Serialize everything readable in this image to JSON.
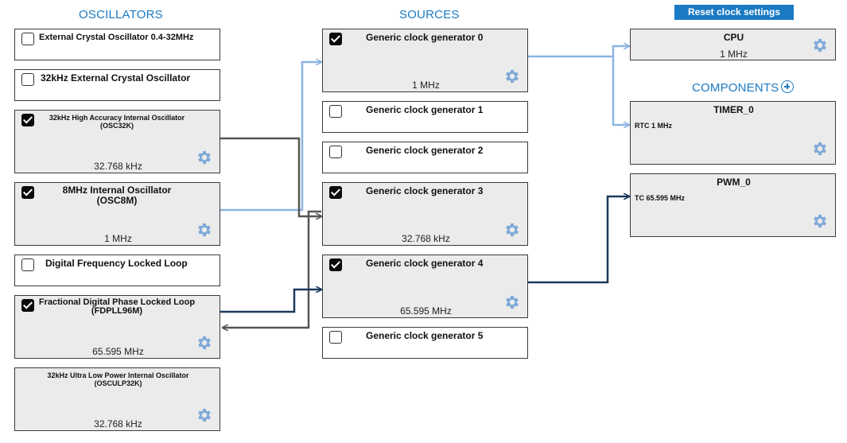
{
  "headers": {
    "oscillators": "OSCILLATORS",
    "sources": "SOURCES",
    "components": "COMPONENTS"
  },
  "reset_button": "Reset clock settings",
  "oscillators": [
    {
      "title": "External Crystal Oscillator 0.4-32MHz",
      "checked": false
    },
    {
      "title": "32kHz External Crystal Oscillator",
      "checked": false
    },
    {
      "title": "32kHz High Accuracy Internal Oscillator",
      "sub": "(OSC32K)",
      "checked": true,
      "freq": "32.768 kHz"
    },
    {
      "title": "8MHz Internal Oscillator",
      "sub": "(OSC8M)",
      "checked": true,
      "freq": "1 MHz"
    },
    {
      "title": "Digital Frequency Locked Loop",
      "checked": false
    },
    {
      "title": "Fractional Digital Phase Locked Loop",
      "sub": "(FDPLL96M)",
      "checked": true,
      "freq": "65.595 MHz"
    },
    {
      "title": "32kHz Ultra Low Power Internal Oscillator",
      "sub": "(OSCULP32K)",
      "freq": "32.768 kHz"
    }
  ],
  "sources": [
    {
      "title": "Generic clock generator 0",
      "checked": true,
      "freq": "1 MHz"
    },
    {
      "title": "Generic clock generator 1",
      "checked": false
    },
    {
      "title": "Generic clock generator 2",
      "checked": false
    },
    {
      "title": "Generic clock generator 3",
      "checked": true,
      "freq": "32.768 kHz"
    },
    {
      "title": "Generic clock generator 4",
      "checked": true,
      "freq": "65.595 MHz"
    },
    {
      "title": "Generic clock generator 5",
      "checked": false
    }
  ],
  "cpu": {
    "title": "CPU",
    "freq": "1 MHz"
  },
  "components": [
    {
      "title": "TIMER_0",
      "input": "RTC 1 MHz"
    },
    {
      "title": "PWM_0",
      "input": "TC 65.595 MHz"
    }
  ],
  "icons": {
    "checkbox": "checkbox-icon",
    "gear": "gear-icon",
    "plus": "add-circle-icon"
  },
  "colors": {
    "accent": "#1a7ac4",
    "gear": "#7fa9d8",
    "wire_light": "#8db4e2",
    "wire_dark": "#1b3a5c",
    "wire_gray": "#555555"
  }
}
